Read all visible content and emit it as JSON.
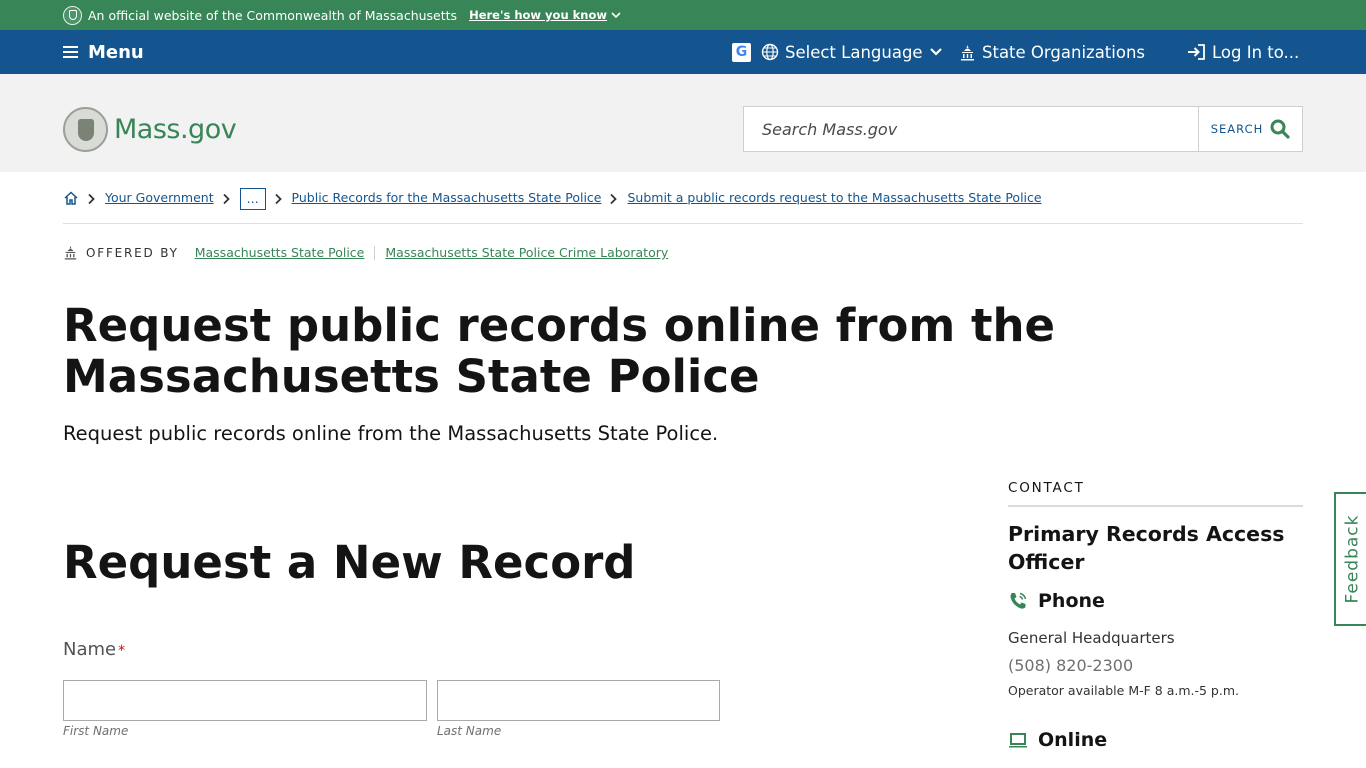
{
  "official_banner": {
    "text": "An official website of the Commonwealth of Massachusetts",
    "how_link": "Here's how you know"
  },
  "utility_nav": {
    "menu_label": "Menu",
    "language_label": "Select Language",
    "state_orgs_label": "State Organizations",
    "login_label": "Log In to..."
  },
  "header": {
    "logo_text": "Mass.gov",
    "search_placeholder": "Search Mass.gov",
    "search_button": "SEARCH"
  },
  "breadcrumb": {
    "items": [
      "Your Government",
      "...",
      "Public Records for the Massachusetts State Police",
      "Submit a public records request to the Massachusetts State Police"
    ]
  },
  "offered_by": {
    "label": "OFFERED BY",
    "orgs": [
      "Massachusetts State Police",
      "Massachusetts State Police Crime Laboratory"
    ]
  },
  "page": {
    "title": "Request public records online from the Massachusetts State Police",
    "lead": "Request public records online from the Massachusetts State Police."
  },
  "form": {
    "heading": "Request a New Record",
    "name_label": "Name",
    "required_mark": "*",
    "first_name_hint": "First Name",
    "last_name_hint": "Last Name"
  },
  "contact": {
    "heading": "CONTACT",
    "name": "Primary Records Access Officer",
    "phone_heading": "Phone",
    "phone_location": "General Headquarters",
    "phone_number": "(508) 820-2300",
    "phone_hours": "Operator available M-F 8 a.m.-5 p.m.",
    "online_heading": "Online"
  },
  "feedback_label": "Feedback",
  "colors": {
    "green": "#388557",
    "blue": "#14558f",
    "header_bg": "#f2f2f2"
  }
}
